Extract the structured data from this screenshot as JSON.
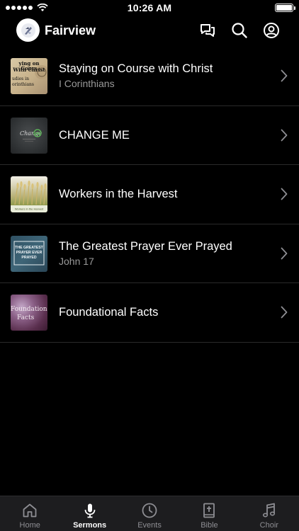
{
  "status_bar": {
    "time": "10:26 AM"
  },
  "header": {
    "title": "Fairview",
    "icons": [
      "chat-icon",
      "search-icon",
      "profile-icon"
    ]
  },
  "sermons": [
    {
      "title": "Staying on Course with Christ",
      "subtitle": "I Corinthians",
      "thumb_caption": "ying on Cours\nWith Christ\nudies in\norinthians"
    },
    {
      "title": "CHANGE ME",
      "subtitle": "",
      "thumb_caption": "Change ME"
    },
    {
      "title": "Workers in the Harvest",
      "subtitle": "",
      "thumb_caption": "Workers in the Harvest"
    },
    {
      "title": "The Greatest Prayer Ever Prayed",
      "subtitle": "John 17",
      "thumb_caption": "THE GREATEST PRAYER EVER PRAYED"
    },
    {
      "title": "Foundational Facts",
      "subtitle": "",
      "thumb_caption": "Foundation Facts"
    }
  ],
  "tabs": [
    {
      "label": "Home",
      "icon": "home-icon",
      "active": false
    },
    {
      "label": "Sermons",
      "icon": "microphone-icon",
      "active": true
    },
    {
      "label": "Events",
      "icon": "clock-icon",
      "active": false
    },
    {
      "label": "Bible",
      "icon": "bible-icon",
      "active": false
    },
    {
      "label": "Choir",
      "icon": "music-note-icon",
      "active": false
    }
  ],
  "colors": {
    "background": "#000000",
    "tab_bar": "#1d1d1f",
    "active_tab": "#ffffff",
    "inactive_tab": "#8e8e93",
    "subtitle": "#9a9a9a"
  }
}
